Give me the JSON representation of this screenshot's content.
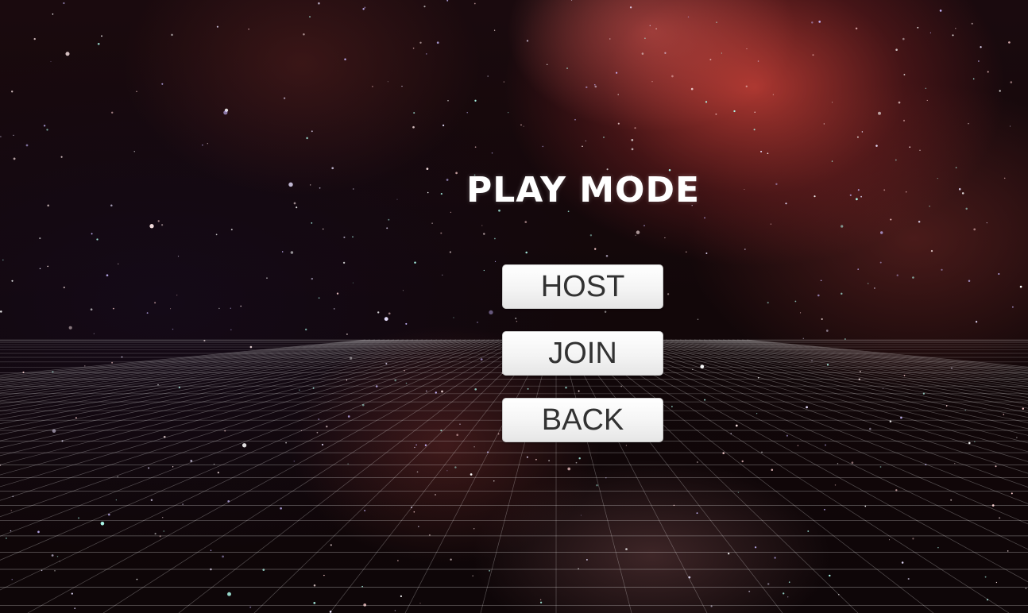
{
  "menu": {
    "title": "PLAY MODE",
    "buttons": {
      "host": "HOST",
      "join": "JOIN",
      "back": "BACK"
    }
  },
  "colors": {
    "title_text": "#ffffff",
    "button_background": "#f4f4f4",
    "button_text": "#323232",
    "grid_lines": "#ffffff",
    "nebula": "#dc463c"
  }
}
